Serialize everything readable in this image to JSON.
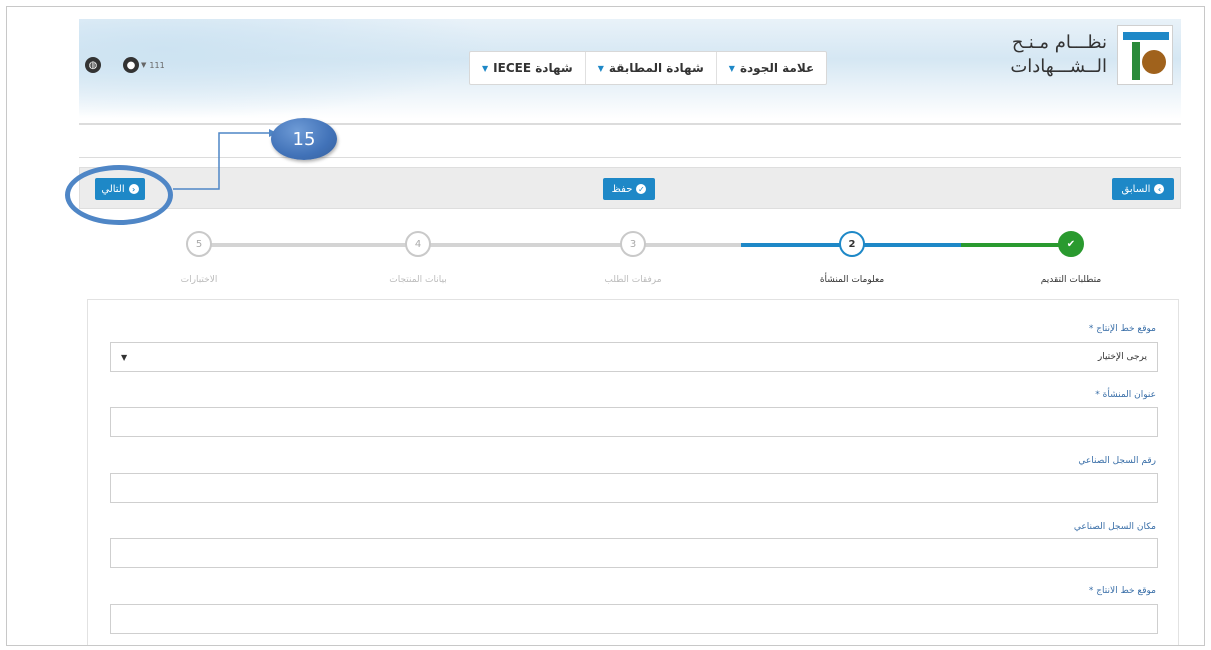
{
  "brand": {
    "line1": "نظـــام مـنـح",
    "line2": "الــشـــهادات"
  },
  "nav": [
    {
      "label": "علامة الجودة"
    },
    {
      "label": "شهادة المطابقة"
    },
    {
      "label": "شهادة IECEE"
    }
  ],
  "user": {
    "name": "111"
  },
  "toolbar": {
    "prev_label": "السابق",
    "save_label": "حفظ",
    "next_label": "التالي"
  },
  "annotation": {
    "number": "15"
  },
  "steps": [
    {
      "number": "✔",
      "label": "متطلبات التقديم",
      "state": "done"
    },
    {
      "number": "2",
      "label": "معلومات المنشأة",
      "state": "active"
    },
    {
      "number": "3",
      "label": "مرفقات الطلب",
      "state": "pending"
    },
    {
      "number": "4",
      "label": "بيانات المنتجات",
      "state": "pending"
    },
    {
      "number": "5",
      "label": "الاختبارات",
      "state": "pending"
    }
  ],
  "form": {
    "f1_label": "موقع خط الإنتاج",
    "f1_value": "يرجى الإختيار",
    "f2_label": "عنوان المنشأة",
    "f3_label": "رقم السجل الصناعي",
    "f4_label": "مكان السجل الصناعي",
    "f5_label": "موقع خط الانتاج",
    "required_mark": "*"
  },
  "colors": {
    "primary": "#1e88c7",
    "done": "#2a9a2f",
    "annotation": "#4f86c6"
  }
}
